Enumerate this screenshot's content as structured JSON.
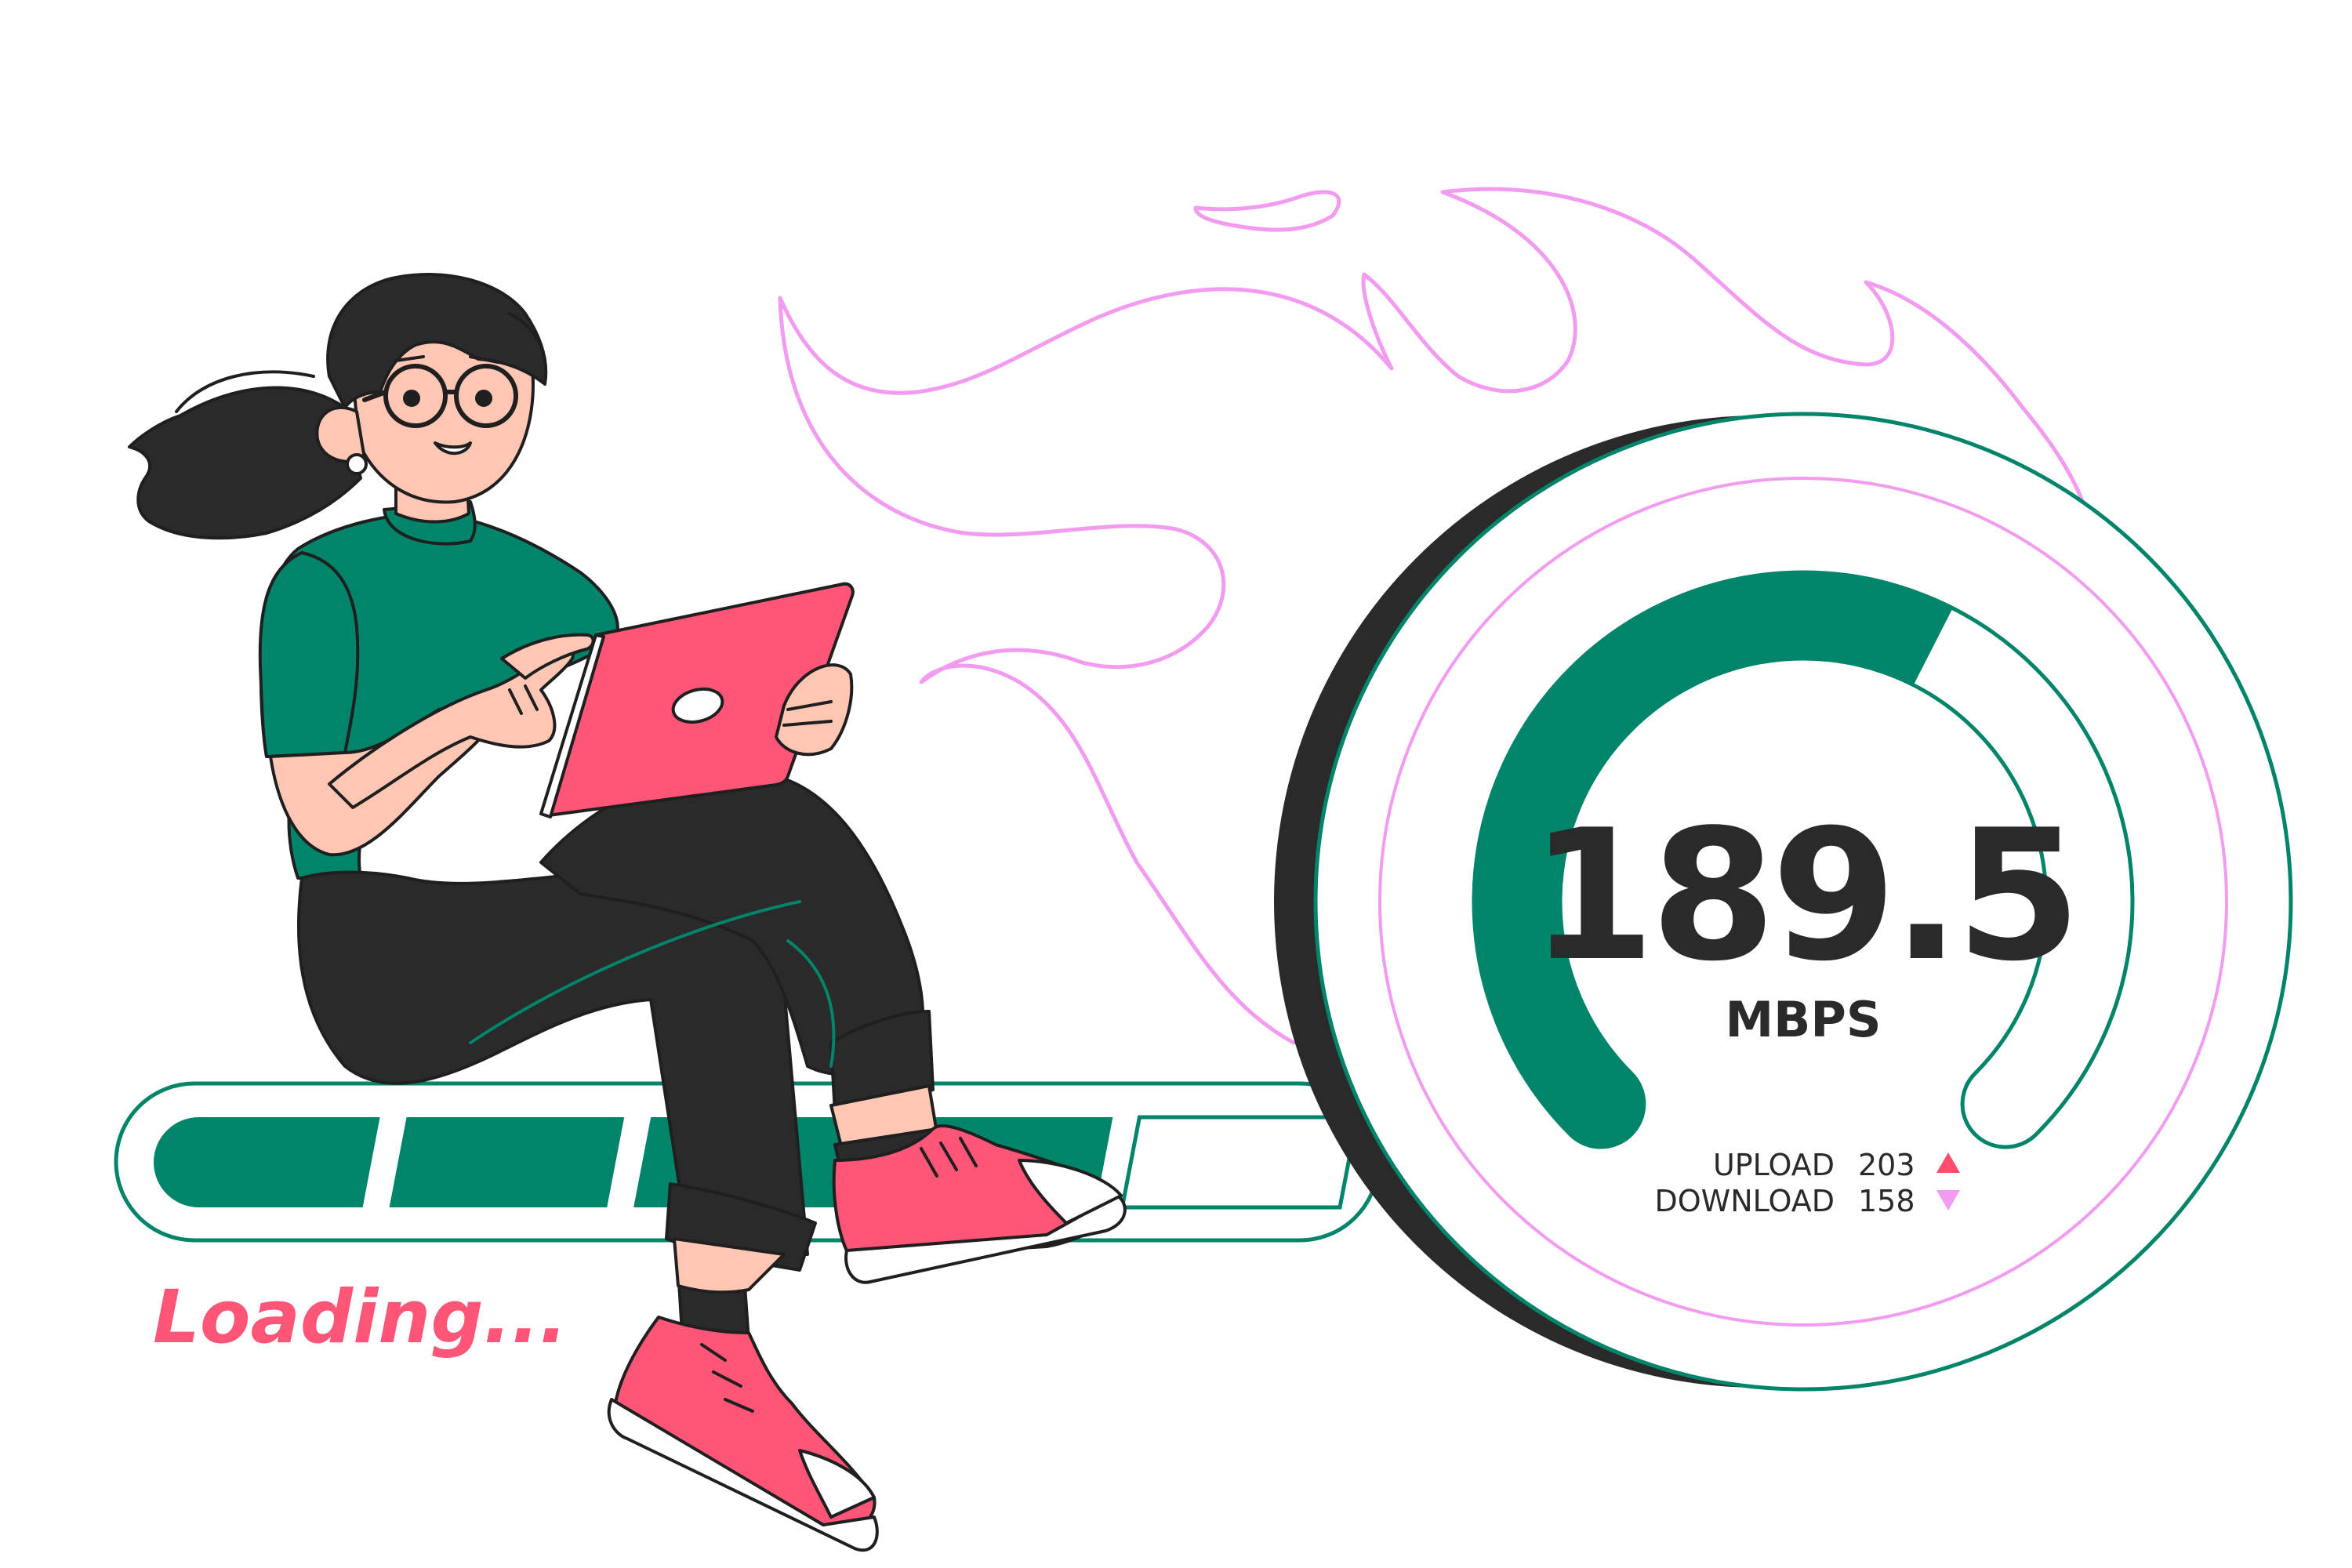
{
  "speedometer": {
    "value": "189.5",
    "unit": "MBPS",
    "gauge_fill_fraction": 0.6,
    "upload_label": "UPLOAD",
    "upload_value": "203",
    "upload_icon": "triangle-up-icon",
    "download_label": "DOWNLOAD",
    "download_value": "158",
    "download_icon": "triangle-down-icon"
  },
  "progress": {
    "label": "Loading...",
    "total_segments": 5,
    "filled_segments": 4
  },
  "colors": {
    "green": "#00856a",
    "pink": "#ff5577",
    "flame": "#f29bf0",
    "dark": "#2a2a2a",
    "skin": "#ffc7b3",
    "upload_arrow": "#ff4d6d",
    "download_arrow": "#f29bf0"
  }
}
